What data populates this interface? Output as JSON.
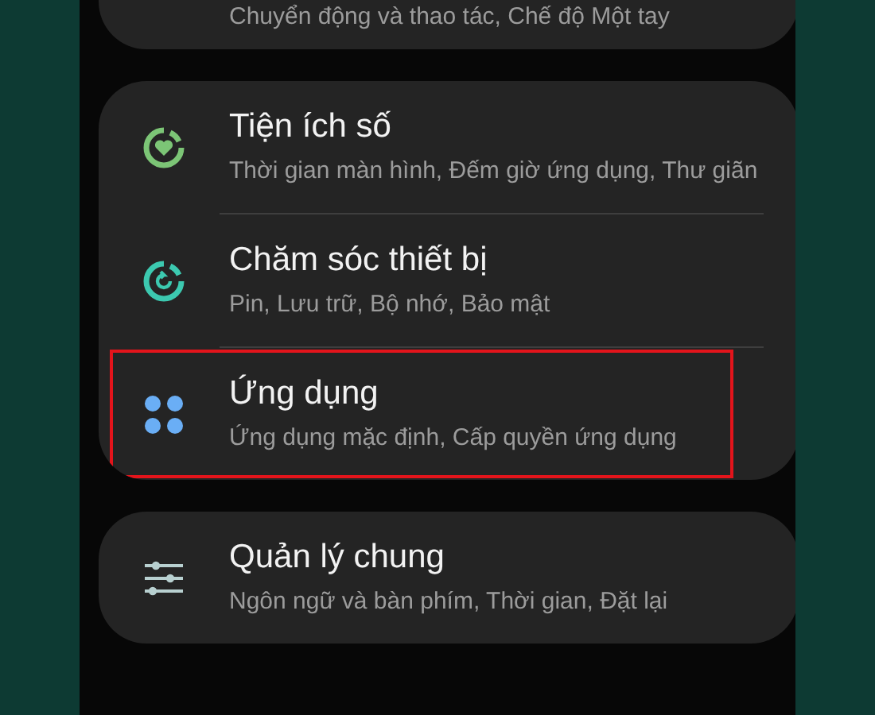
{
  "cards": [
    {
      "items": [
        {
          "kind": "plain",
          "subtitle": "Chuyển động và thao tác, Chế độ Một tay",
          "highlighted": false
        }
      ]
    },
    {
      "items": [
        {
          "kind": "wellbeing",
          "title": "Tiện ích số",
          "subtitle": "Thời gian màn hình, Đếm giờ ứng dụng, Thư giãn",
          "highlighted": false
        },
        {
          "kind": "care",
          "title": "Chăm sóc thiết bị",
          "subtitle": "Pin, Lưu trữ, Bộ nhớ, Bảo mật",
          "highlighted": false
        },
        {
          "kind": "apps",
          "title": "Ứng dụng",
          "subtitle": "Ứng dụng mặc định, Cấp quyền ứng dụng",
          "highlighted": true
        }
      ]
    },
    {
      "items": [
        {
          "kind": "general",
          "title": "Quản lý chung",
          "subtitle": "Ngôn ngữ và bàn phím, Thời gian, Đặt lại",
          "highlighted": false
        }
      ]
    }
  ]
}
